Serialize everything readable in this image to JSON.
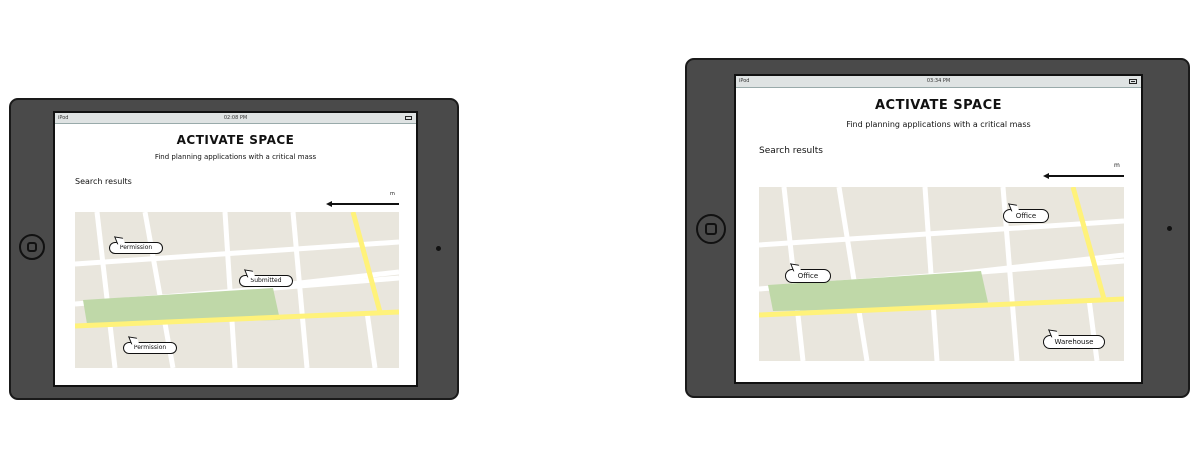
{
  "screens": [
    {
      "status": {
        "carrier": "iPod",
        "time": "02:08 PM"
      },
      "header": {
        "title": "ACTIVATE SPACE",
        "subtitle": "Find planning applications with a critical mass"
      },
      "results_label": "Search results",
      "scale_unit": "m",
      "markers": [
        {
          "label": "Permission"
        },
        {
          "label": "Submitted"
        },
        {
          "label": "Permission"
        }
      ],
      "colors": {
        "park": "#bfd8a8",
        "road_major": "#fff27a",
        "map_bg": "#e9e6dd"
      }
    },
    {
      "status": {
        "carrier": "iPod",
        "time": "03:34 PM"
      },
      "header": {
        "title": "ACTIVATE SPACE",
        "subtitle": "Find planning applications with a critical mass"
      },
      "results_label": "Search results",
      "scale_unit": "m",
      "markers": [
        {
          "label": "Office"
        },
        {
          "label": "Office"
        },
        {
          "label": "Warehouse"
        }
      ],
      "colors": {
        "park": "#bfd8a8",
        "road_major": "#fff27a",
        "map_bg": "#e9e6dd"
      }
    }
  ]
}
